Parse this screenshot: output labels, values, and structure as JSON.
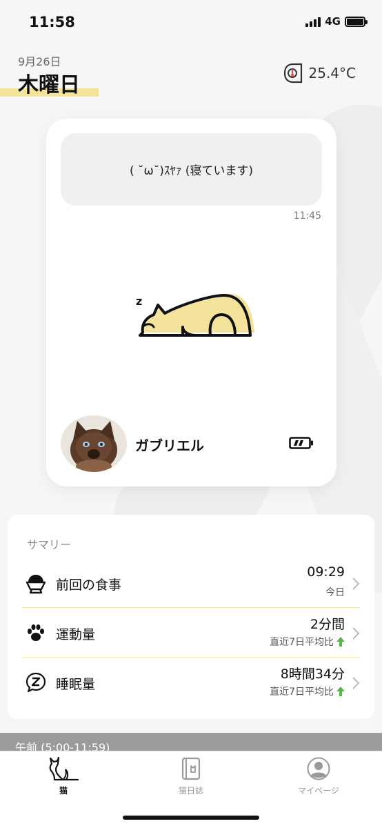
{
  "status": {
    "time": "11:58",
    "network": "4G"
  },
  "header": {
    "date": "9月26日",
    "weekday": "木曜日",
    "temperature": "25.4°C"
  },
  "cat_card": {
    "message": "( ˘ω˘)ｽﾔｧ (寝ています)",
    "message_time": "11:45",
    "sleep_symbol": "z",
    "cat_name": "ガブリエル"
  },
  "summary": {
    "title": "サマリー",
    "rows": [
      {
        "icon": "food-bowl-icon",
        "label": "前回の食事",
        "value": "09:29",
        "sub": "今日",
        "trend": ""
      },
      {
        "icon": "paw-icon",
        "label": "運動量",
        "value": "2分間",
        "sub": "直近7日平均比",
        "trend": "up"
      },
      {
        "icon": "sleep-bubble-icon",
        "label": "睡眠量",
        "value": "8時間34分",
        "sub": "直近7日平均比",
        "trend": "up"
      }
    ]
  },
  "section": {
    "label": "午前 (5:00-11:59)"
  },
  "tabs": [
    {
      "label": "猫",
      "active": true
    },
    {
      "label": "猫日誌",
      "active": false
    },
    {
      "label": "マイページ",
      "active": false
    }
  ],
  "colors": {
    "accent_yellow": "#f4e39a",
    "trend_green": "#5ab54a",
    "active_tab": "#111111",
    "inactive_tab": "#999999"
  }
}
